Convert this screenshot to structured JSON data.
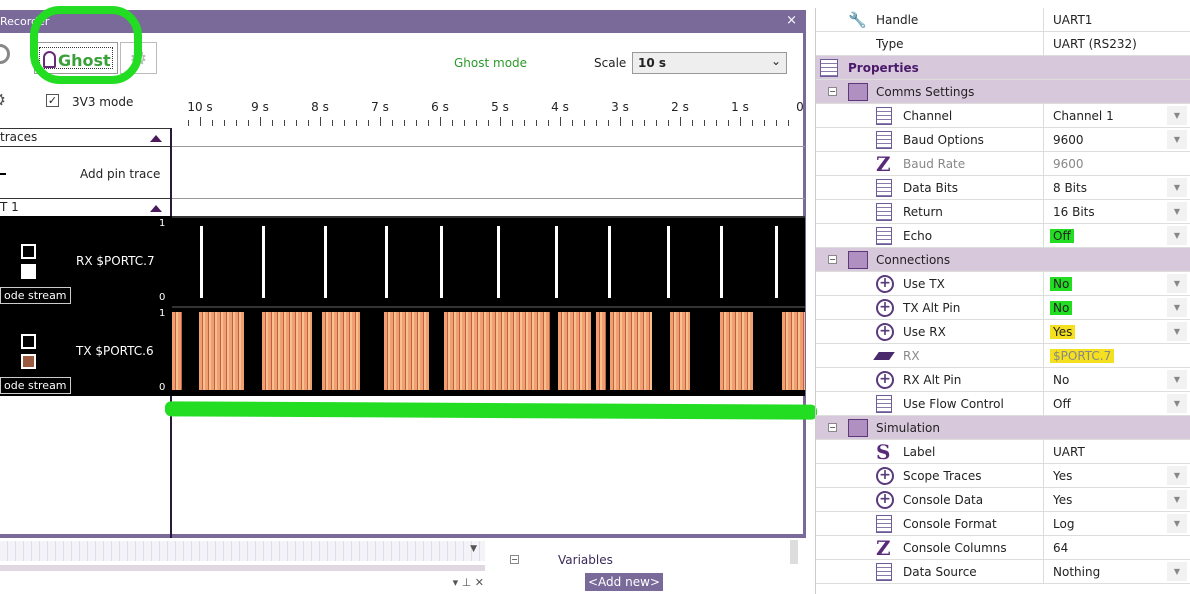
{
  "recorder": {
    "title": "Recorder",
    "close": "×",
    "ghost_label": "Ghost",
    "ghost_mode_label": "Ghost mode",
    "scale_label": "Scale",
    "scale_value": "10 s",
    "v33_label": "3V3 mode",
    "v33_checked": true,
    "time_ticks": [
      "10 s",
      "9 s",
      "8 s",
      "7 s",
      "6 s",
      "5 s",
      "4 s",
      "3 s",
      "2 s",
      "1 s",
      "0"
    ],
    "section_traces": "traces",
    "add_pin_trace": "Add pin trace",
    "section_uart": "T 1",
    "traces": [
      {
        "label": "RX $PORTC.7",
        "mode": "ode stream",
        "max": "1",
        "min": "0",
        "color": "#ffffff"
      },
      {
        "label": "TX $PORTC.6",
        "mode": "ode stream",
        "max": "1",
        "min": "0",
        "color": "#f0a070"
      }
    ]
  },
  "bottom": {
    "variables": "Variables",
    "add_new": "<Add new>"
  },
  "properties": {
    "rows": [
      {
        "type": "item",
        "icon": "wrench-icon",
        "name": "Handle",
        "value": "UART1"
      },
      {
        "type": "item",
        "icon": "none",
        "name": "Type",
        "value": "UART (RS232)"
      },
      {
        "type": "header",
        "icon": "properties-icon",
        "name": "Properties"
      },
      {
        "type": "group",
        "icon": "folder-icon",
        "name": "Comms Settings"
      },
      {
        "type": "item",
        "icon": "list-icon",
        "name": "Channel",
        "value": "Channel 1",
        "dropdown": true
      },
      {
        "type": "item",
        "icon": "list-icon",
        "name": "Baud Options",
        "value": "9600",
        "dropdown": true
      },
      {
        "type": "item",
        "icon": "z-icon",
        "name": "Baud Rate",
        "value": "9600",
        "disabled": true
      },
      {
        "type": "item",
        "icon": "list-icon",
        "name": "Data Bits",
        "value": "8 Bits",
        "dropdown": true
      },
      {
        "type": "item",
        "icon": "list-icon",
        "name": "Return",
        "value": "16 Bits",
        "dropdown": true
      },
      {
        "type": "item",
        "icon": "list-icon",
        "name": "Echo",
        "value": "Off",
        "dropdown": true,
        "highlight": "#22dd22"
      },
      {
        "type": "group",
        "icon": "folder-icon",
        "name": "Connections"
      },
      {
        "type": "item",
        "icon": "plus-icon",
        "name": "Use TX",
        "value": "No",
        "dropdown": true,
        "highlight": "#22dd22"
      },
      {
        "type": "item",
        "icon": "plus-icon",
        "name": "TX Alt Pin",
        "value": "No",
        "dropdown": true,
        "highlight": "#22dd22"
      },
      {
        "type": "item",
        "icon": "plus-icon",
        "name": "Use RX",
        "value": "Yes",
        "dropdown": true,
        "highlight": "#f5e020"
      },
      {
        "type": "item",
        "icon": "pin-icon",
        "name": "RX",
        "value": "$PORTC.7",
        "disabled": true,
        "highlight": "#f5e020"
      },
      {
        "type": "item",
        "icon": "plus-icon",
        "name": "RX Alt Pin",
        "value": "No",
        "dropdown": true
      },
      {
        "type": "item",
        "icon": "list-icon",
        "name": "Use Flow Control",
        "value": "Off",
        "dropdown": true
      },
      {
        "type": "group",
        "icon": "folder-icon",
        "name": "Simulation"
      },
      {
        "type": "item",
        "icon": "s-icon",
        "name": "Label",
        "value": "UART"
      },
      {
        "type": "item",
        "icon": "plus-icon",
        "name": "Scope Traces",
        "value": "Yes",
        "dropdown": true
      },
      {
        "type": "item",
        "icon": "plus-icon",
        "name": "Console Data",
        "value": "Yes",
        "dropdown": true
      },
      {
        "type": "item",
        "icon": "list-icon",
        "name": "Console Format",
        "value": "Log",
        "dropdown": true
      },
      {
        "type": "item",
        "icon": "z-icon",
        "name": "Console Columns",
        "value": "64"
      },
      {
        "type": "item",
        "icon": "list-icon",
        "name": "Data Source",
        "value": "Nothing",
        "dropdown": true
      }
    ]
  },
  "colors": {
    "accent": "#7a6a9a",
    "annotation": "#22dd22"
  }
}
